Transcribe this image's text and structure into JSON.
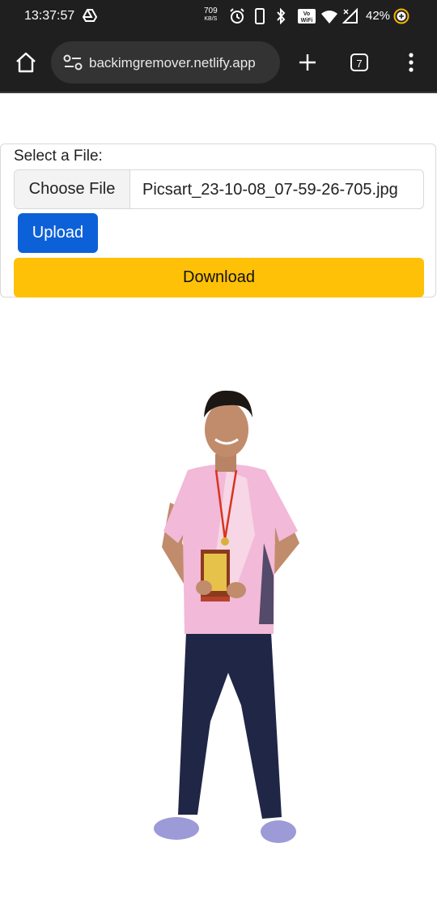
{
  "status_bar": {
    "time": "13:37:57",
    "net_speed_value": "709",
    "net_speed_unit": "KB/S",
    "battery_percent": "42%",
    "icons": [
      "drive-icon",
      "alarm-icon",
      "phone-icon",
      "bluetooth-icon",
      "volte-wifi-icon",
      "wifi-icon",
      "signal-icon",
      "battery-saver-icon"
    ]
  },
  "browser": {
    "url": "backimgremover.netlify.app",
    "tab_count": "7",
    "icons": [
      "home-icon",
      "site-settings-icon",
      "new-tab-icon",
      "tabs-icon",
      "menu-icon"
    ]
  },
  "form": {
    "label": "Select a File:",
    "choose_file_label": "Choose File",
    "file_name": "Picsart_23-10-08_07-59-26-705.jpg",
    "upload_label": "Upload",
    "download_label": "Download"
  },
  "colors": {
    "upload_button": "#0d61d8",
    "download_button": "#ffc107",
    "chrome_bar": "#1f1f1f"
  }
}
